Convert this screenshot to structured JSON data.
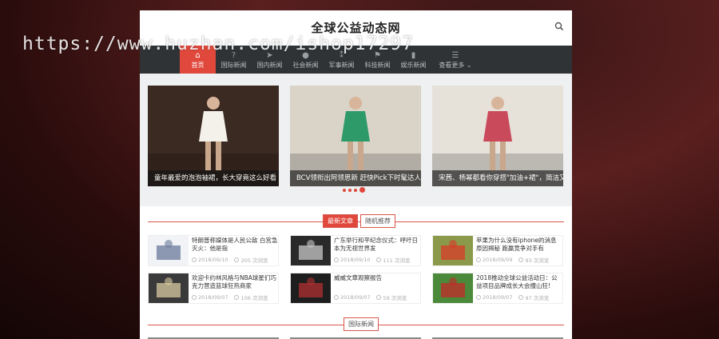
{
  "watermark": "https://www.huzhan.com/ishop17297",
  "site": {
    "title": "全球公益动态网"
  },
  "nav": {
    "items": [
      {
        "label": "首页",
        "icon": "home-icon",
        "glyph": "⌂",
        "active": true
      },
      {
        "label": "国际新闻",
        "icon": "question-icon",
        "glyph": "?"
      },
      {
        "label": "国内新闻",
        "icon": "send-icon",
        "glyph": "➤"
      },
      {
        "label": "社会新闻",
        "icon": "globe-icon",
        "glyph": "●"
      },
      {
        "label": "军事新闻",
        "icon": "road-icon",
        "glyph": "⁑"
      },
      {
        "label": "科技新闻",
        "icon": "flag-icon",
        "glyph": "⚑"
      },
      {
        "label": "娱乐新闻",
        "icon": "file-icon",
        "glyph": "▮"
      },
      {
        "label": "查看更多",
        "icon": "list-icon",
        "glyph": "☰",
        "dropdown": true
      }
    ]
  },
  "slider": {
    "slides": [
      {
        "caption": "童年最爱的泡泡袖裙，长大穿竟这么好看",
        "palette": [
          "#3b2a22",
          "#f4f0ea"
        ]
      },
      {
        "caption": "BCV领衔出阿领思新 赶快Pick下时髦达人",
        "palette": [
          "#d9d3c8",
          "#2e9a6a"
        ]
      },
      {
        "caption": "宋茜、杨幂都看你穿搭\"加油+裙\"，简洁又时髦",
        "palette": [
          "#e6e1d9",
          "#c94a5a"
        ]
      }
    ],
    "dots": 4,
    "active_dot": 3
  },
  "tabs": [
    {
      "label": "最新文章",
      "active": true
    },
    {
      "label": "随机推荐",
      "active": false
    }
  ],
  "articles": [
    {
      "title": "特朗普称媒体是人民公敌 白宫急灭火：他是指",
      "date": "2018/09/10",
      "views": "205 次浏览",
      "thumb": [
        "#f1f3f6",
        "#6a7a9a"
      ]
    },
    {
      "title": "广东举行和平纪念仪式：呼吁日本为无视世界发",
      "date": "2018/09/10",
      "views": "111 次浏览",
      "thumb": [
        "#2a2a2a",
        "#c8c8c8"
      ]
    },
    {
      "title": "苹果为什么没有iphone的消息原因揭秘 跑赢竞争对手有",
      "date": "2018/09/09",
      "views": "93 次浏览",
      "thumb": [
        "#8a9a4a",
        "#d83a2a"
      ]
    },
    {
      "title": "欢迎卡约林风格与NBA球星们巧克力营造篮球狂热商家",
      "date": "2018/09/07",
      "views": "106 次浏览",
      "thumb": [
        "#3a3a3a",
        "#d8c9a0"
      ]
    },
    {
      "title": "威威文章观察报告",
      "date": "2018/09/07",
      "views": "59 次浏览",
      "thumb": [
        "#1e1e1e",
        "#b03030"
      ]
    },
    {
      "title": "2018推动全球公益活动日：公益项目品牌成长大会撞山狂!",
      "date": "2018/09/07",
      "views": "97 次浏览",
      "thumb": [
        "#4a8a3a",
        "#c42a2a"
      ]
    }
  ],
  "section2": {
    "label": "国际新闻"
  },
  "colors": {
    "accent": "#e0483c",
    "nav_bg": "#2f3336"
  }
}
